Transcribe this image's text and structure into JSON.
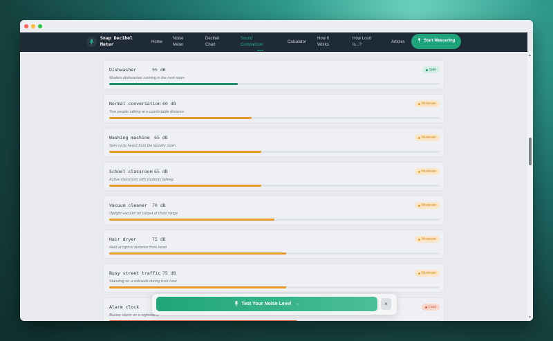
{
  "app": {
    "brand": "Snap Decibel Meter",
    "accent_color": "#1ea37a"
  },
  "nav": {
    "items": [
      {
        "label": "Home"
      },
      {
        "label": "Noise Meter"
      },
      {
        "label": "Decibel Chart"
      },
      {
        "label": "Sound Comparison",
        "active": true
      },
      {
        "label": "Calculator"
      },
      {
        "label": "How It Works"
      },
      {
        "label": "How Loud Is...?"
      },
      {
        "label": "Articles"
      }
    ],
    "cta": "Start Measuring",
    "cta_icon": "mic-icon"
  },
  "sounds": [
    {
      "name": "Dishwasher",
      "db": "55 dB",
      "desc": "Modern dishwasher running in the next room",
      "level": "Safe",
      "level_fraction": 0.39
    },
    {
      "name": "Normal conversation",
      "db": "60 dB",
      "desc": "Two people talking at a comfortable distance",
      "level": "Moderate",
      "level_fraction": 0.43
    },
    {
      "name": "Washing machine",
      "db": "65 dB",
      "desc": "Spin cycle heard from the laundry room",
      "level": "Moderate",
      "level_fraction": 0.46
    },
    {
      "name": "School classroom",
      "db": "65 dB",
      "desc": "Active classroom with students talking",
      "level": "Moderate",
      "level_fraction": 0.46
    },
    {
      "name": "Vacuum cleaner",
      "db": "70 dB",
      "desc": "Upright vacuum on carpet at close range",
      "level": "Moderate",
      "level_fraction": 0.5
    },
    {
      "name": "Hair dryer",
      "db": "75 dB",
      "desc": "Held at typical distance from head",
      "level": "Moderate",
      "level_fraction": 0.535
    },
    {
      "name": "Busy street traffic",
      "db": "75 dB",
      "desc": "Standing on a sidewalk during rush hour",
      "level": "Moderate",
      "level_fraction": 0.535
    },
    {
      "name": "Alarm clock",
      "db": "",
      "desc": "Buzzer alarm on a nightstand",
      "level": "Loud",
      "level_fraction": 0.57
    }
  ],
  "colors": {
    "safe": "#1e8d68",
    "moderate": "#e59a2a",
    "loud": "#e0603e"
  },
  "test_bar": {
    "button_label": "Test Your Noise Level",
    "close_label": "×"
  }
}
